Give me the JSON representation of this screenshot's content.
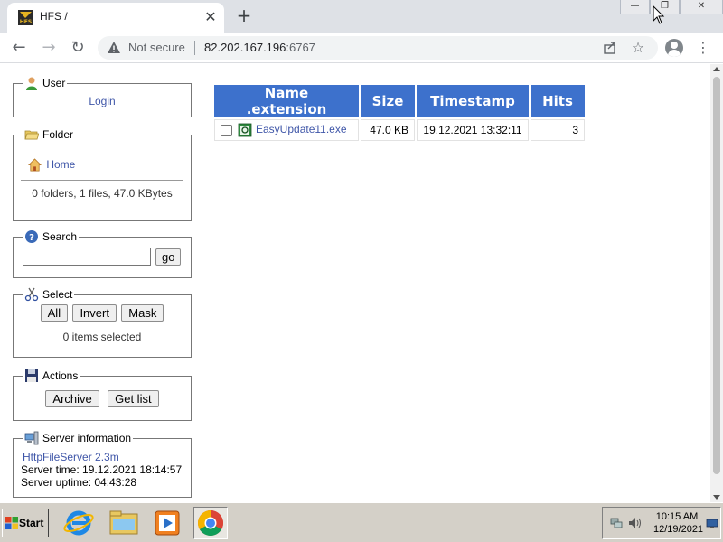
{
  "browser": {
    "tab_title": "HFS /",
    "tab_close": "✕",
    "new_tab": "+",
    "window_buttons": [
      "—",
      "❐",
      "✕"
    ],
    "not_secure": "Not secure",
    "url_host": "82.202.167.196",
    "url_port": ":6767",
    "icons": [
      "back-arrow-icon",
      "forward-arrow-icon",
      "reload-icon",
      "warning-icon",
      "share-icon",
      "star-icon",
      "profile-icon",
      "kebab-menu-icon"
    ]
  },
  "sidebar": {
    "user": {
      "legend": "User",
      "login": "Login"
    },
    "folder": {
      "legend": "Folder",
      "home": "Home",
      "summary": "0 folders, 1 files, 47.0 KBytes"
    },
    "search": {
      "legend": "Search",
      "go": "go",
      "value": ""
    },
    "select": {
      "legend": "Select",
      "all": "All",
      "invert": "Invert",
      "mask": "Mask",
      "status": "0 items selected"
    },
    "actions": {
      "legend": "Actions",
      "archive": "Archive",
      "get_list": "Get list"
    },
    "server": {
      "legend": "Server information",
      "name": "HttpFileServer 2.3m",
      "time": "Server time: 19.12.2021 18:14:57",
      "uptime": "Server uptime: 04:43:28"
    }
  },
  "files": {
    "headers": [
      "Name .extension",
      "Size",
      "Timestamp",
      "Hits"
    ],
    "rows": [
      {
        "name": "EasyUpdate11.exe",
        "size": "47.0 KB",
        "timestamp": "19.12.2021 13:32:11",
        "hits": "3"
      }
    ]
  },
  "taskbar": {
    "start": "Start",
    "apps": [
      "internet-explorer-icon",
      "file-explorer-icon",
      "media-player-icon",
      "chrome-icon"
    ],
    "time": "10:15 AM",
    "date": "12/19/2021"
  }
}
